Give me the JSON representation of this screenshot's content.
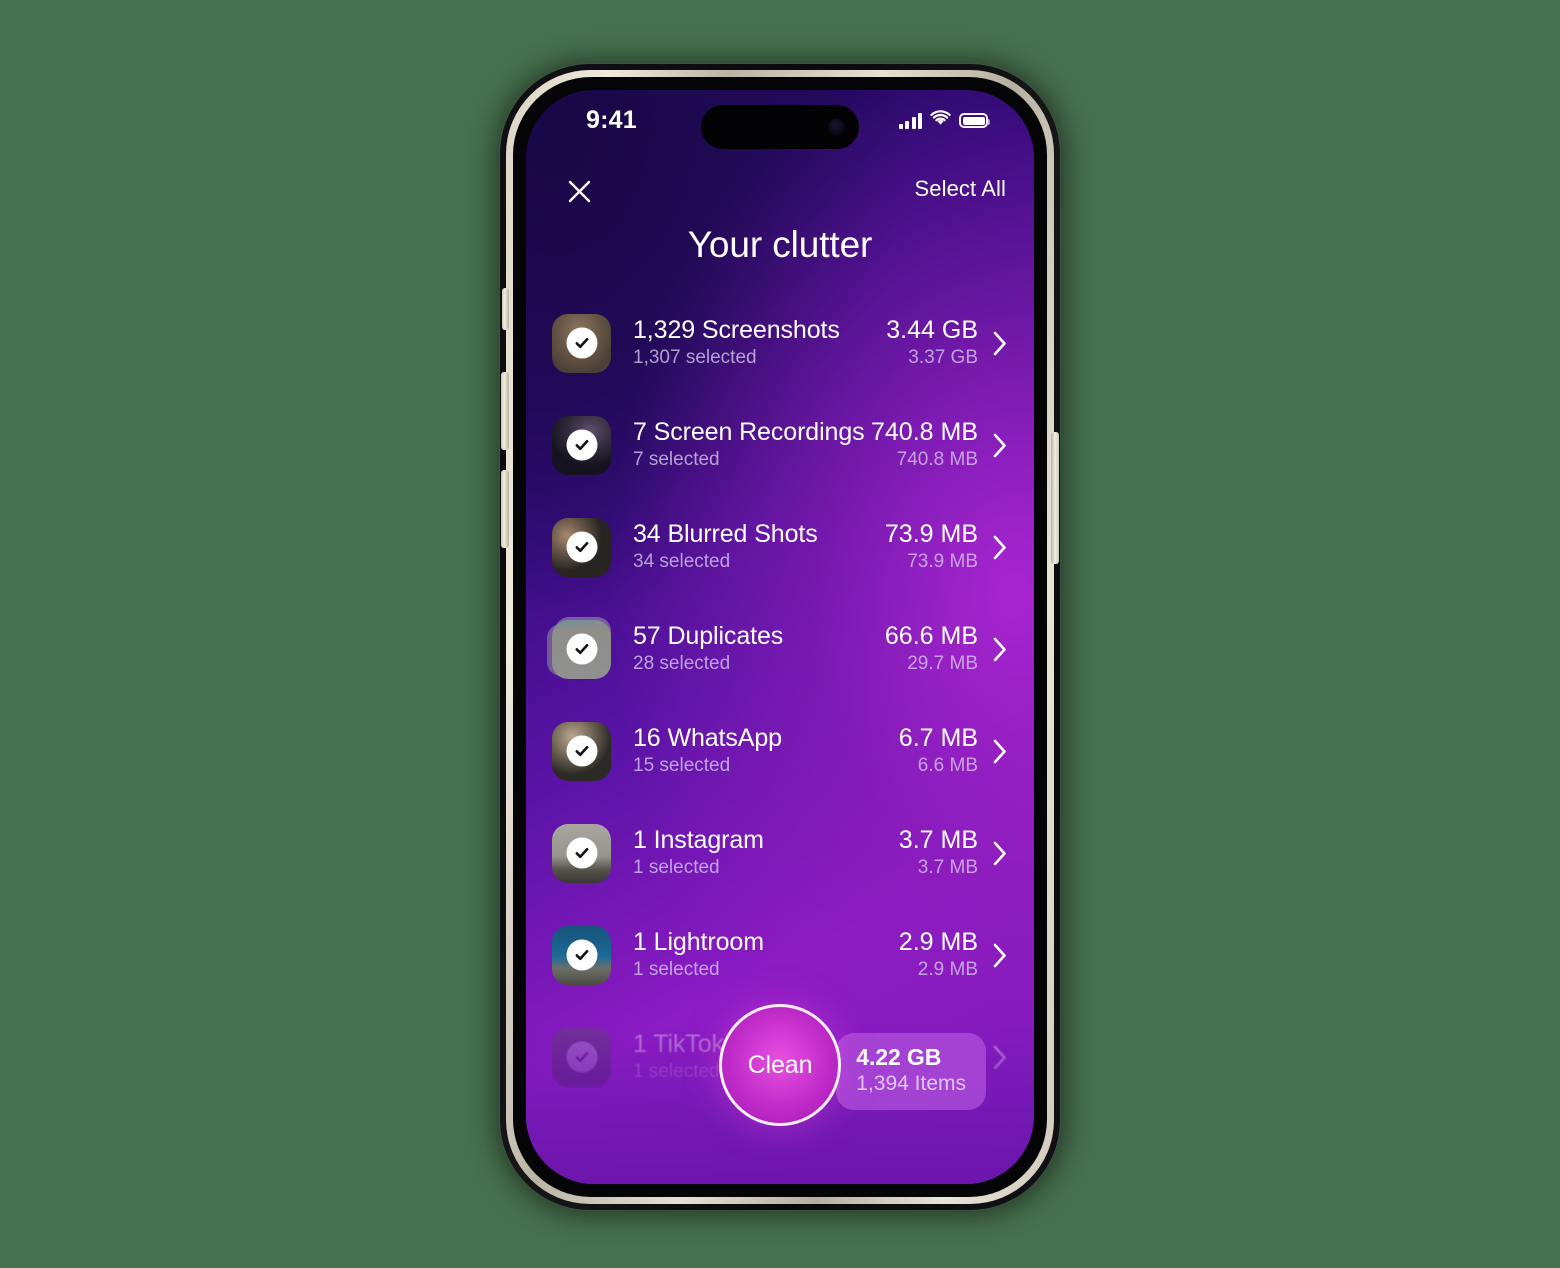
{
  "theme": {
    "page_background": "#47704E",
    "screen_gradient_from": "#1C0754",
    "screen_gradient_to": "#8C1BC4",
    "accent_magenta": "#D63FD6",
    "badge_purple": "#B756E0"
  },
  "status_bar": {
    "time": "9:41",
    "signal_icon": "cellular-signal-icon",
    "wifi_icon": "wifi-icon",
    "battery_icon": "battery-full-icon"
  },
  "nav": {
    "close_icon": "close-icon",
    "select_all_label": "Select All"
  },
  "header": {
    "title": "Your clutter"
  },
  "list": {
    "items": [
      {
        "title": "1,329 Screenshots",
        "subtitle": "1,307 selected",
        "size": "3.44 GB",
        "size_selected": "3.37 GB",
        "thumb": "screenshot-thumbnail",
        "checked": true,
        "dimmed": false
      },
      {
        "title": "7 Screen Recordings",
        "subtitle": "7 selected",
        "size": "740.8 MB",
        "size_selected": "740.8 MB",
        "thumb": "screen-recording-thumbnail",
        "checked": true,
        "dimmed": false
      },
      {
        "title": "34 Blurred Shots",
        "subtitle": "34 selected",
        "size": "73.9 MB",
        "size_selected": "73.9 MB",
        "thumb": "blurred-shot-thumbnail",
        "checked": true,
        "dimmed": false
      },
      {
        "title": "57 Duplicates",
        "subtitle": "28 selected",
        "size": "66.6 MB",
        "size_selected": "29.7 MB",
        "thumb": "duplicates-stacked-thumbnail",
        "checked": true,
        "dimmed": false
      },
      {
        "title": "16 WhatsApp",
        "subtitle": "15 selected",
        "size": "6.7 MB",
        "size_selected": "6.6 MB",
        "thumb": "whatsapp-thumbnail",
        "checked": true,
        "dimmed": false
      },
      {
        "title": "1 Instagram",
        "subtitle": "1 selected",
        "size": "3.7 MB",
        "size_selected": "3.7 MB",
        "thumb": "instagram-thumbnail",
        "checked": true,
        "dimmed": false
      },
      {
        "title": "1 Lightroom",
        "subtitle": "1 selected",
        "size": "2.9 MB",
        "size_selected": "2.9 MB",
        "thumb": "lightroom-thumbnail",
        "checked": true,
        "dimmed": false
      },
      {
        "title": "1 TikTok",
        "subtitle": "1 selected",
        "size": "",
        "size_selected": "",
        "thumb": "tiktok-thumbnail",
        "checked": true,
        "dimmed": true
      }
    ],
    "chevron_icon": "chevron-right-icon"
  },
  "footer": {
    "clean_label": "Clean",
    "summary_size": "4.22 GB",
    "summary_items": "1,394 Items"
  }
}
